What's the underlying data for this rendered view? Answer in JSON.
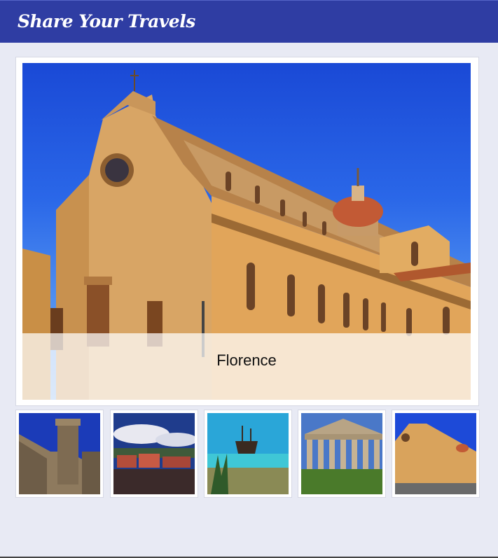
{
  "header": {
    "title": "Share Your Travels"
  },
  "featured": {
    "caption": "Florence"
  },
  "thumbnails": [
    {
      "subject": "castle"
    },
    {
      "subject": "harbor"
    },
    {
      "subject": "pirate-ship"
    },
    {
      "subject": "temple"
    },
    {
      "subject": "florence-church"
    }
  ],
  "colors": {
    "header_bg": "#2f3da3",
    "page_bg": "#e8eaf4",
    "frame_bg": "#ffffff",
    "sky": "#1a49d6",
    "stucco": "#d9a35c"
  }
}
